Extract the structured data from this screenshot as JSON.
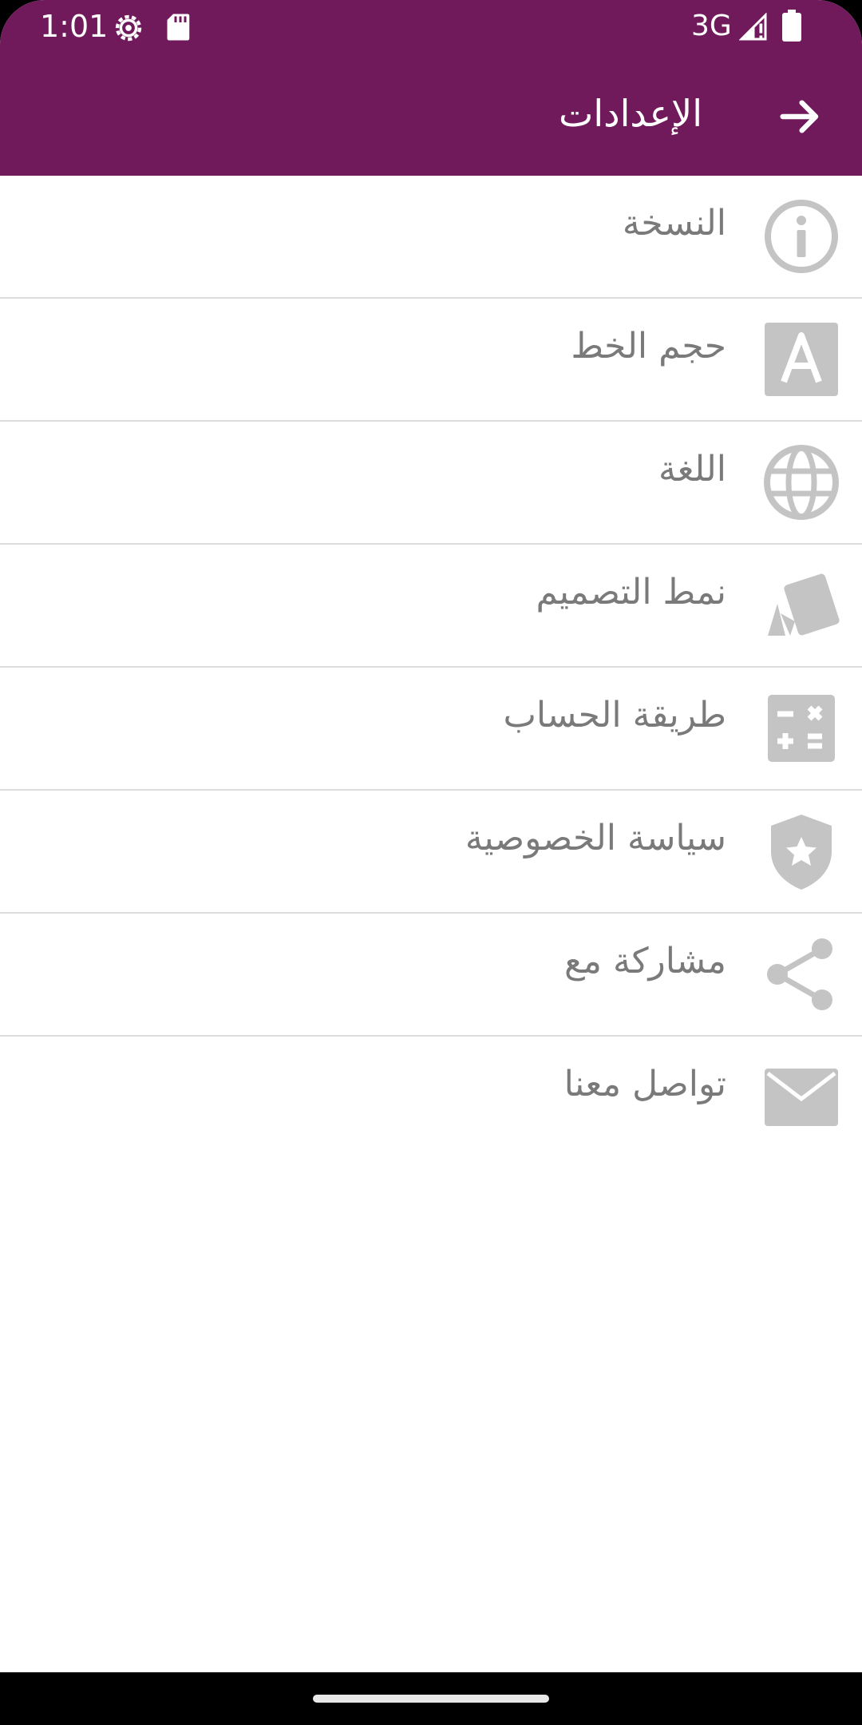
{
  "status_bar": {
    "time": "1:01",
    "network": "3G",
    "icons": [
      "gear-icon",
      "sd-card-icon",
      "signal-icon",
      "battery-icon"
    ]
  },
  "app_bar": {
    "title": "الإعدادات",
    "back_icon": "arrow-right-icon",
    "background": "#701a5c"
  },
  "settings": {
    "items": [
      {
        "label": "النسخة",
        "icon": "info-icon"
      },
      {
        "label": "حجم الخط",
        "icon": "font-size-icon"
      },
      {
        "label": "اللغة",
        "icon": "globe-icon"
      },
      {
        "label": "نمط التصميم",
        "icon": "style-cards-icon"
      },
      {
        "label": "طريقة الحساب",
        "icon": "calculator-icon"
      },
      {
        "label": "سياسة الخصوصية",
        "icon": "privacy-shield-icon"
      },
      {
        "label": "مشاركة مع",
        "icon": "share-icon"
      },
      {
        "label": "تواصل معنا",
        "icon": "mail-icon"
      }
    ]
  },
  "colors": {
    "accent": "#701a5c",
    "icon_gray": "#c4c4c4",
    "label_gray": "#7a7a7a",
    "divider": "#dcdcdc"
  }
}
